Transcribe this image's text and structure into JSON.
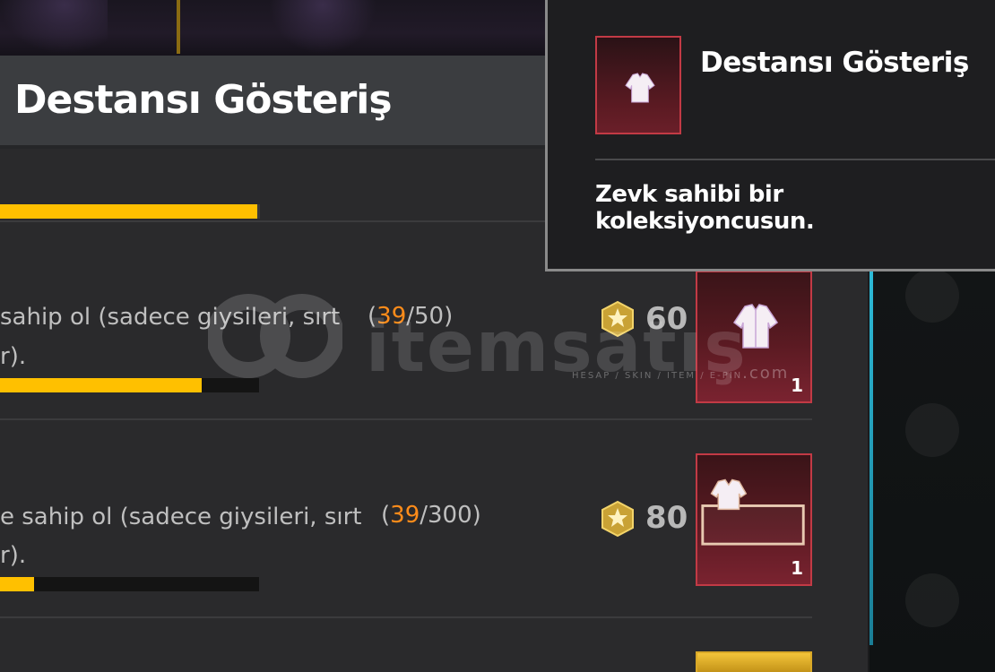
{
  "header": {
    "title": "Destansı Gösteriş"
  },
  "tasks": [
    {
      "text_line1": "sahip ol (sadece giysileri, sırt",
      "text_line2": "r).",
      "progress_current": "39",
      "progress_sep": "/",
      "progress_total": "50)",
      "progress_open": "(",
      "progress_fraction": 0.78,
      "points": "60",
      "reward_qty": "1"
    },
    {
      "text_line1": "e sahip ol (sadece giysileri, sırt",
      "text_line2": "r).",
      "progress_current": "39",
      "progress_sep": "/",
      "progress_total": "300)",
      "progress_open": "(",
      "progress_fraction": 0.13,
      "points": "80",
      "reward_qty": "1"
    }
  ],
  "tooltip": {
    "title": "Destansı Gösteriş",
    "description": "Zevk sahibi bir koleksiyoncusun."
  },
  "watermark": {
    "brand": "itemsatış",
    "tagline": "HESAP / SKIN / ITEM / E-PIN",
    "suffix": ".com"
  },
  "colors": {
    "progress": "#ffc000",
    "current_count": "#ff8c1a",
    "reward_border": "#c23a45",
    "accent_cyan": "#2dbbd8"
  },
  "icons": {
    "coin": "achievement-coin-icon",
    "reward": "jacket-icon",
    "close": "close-icon"
  }
}
